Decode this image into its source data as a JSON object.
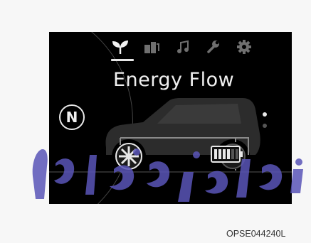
{
  "display": {
    "title": "Energy Flow",
    "gear": "N",
    "tabs": [
      {
        "name": "eco-tab",
        "icon": "leaf-icon",
        "active": true
      },
      {
        "name": "fuel-tab",
        "icon": "fuel-station-icon",
        "active": false
      },
      {
        "name": "audio-tab",
        "icon": "music-note-icon",
        "active": false
      },
      {
        "name": "service-tab",
        "icon": "wrench-icon",
        "active": false
      },
      {
        "name": "settings-tab",
        "icon": "gear-icon",
        "active": false
      }
    ],
    "page_indicator": {
      "total": 2,
      "current": 1
    }
  },
  "caption": "OPSE044240L",
  "watermark_text": "مدادخودروكارما",
  "colors": {
    "screen_bg": "#000000",
    "active_icon": "#f2f2f2",
    "inactive_icon": "#6f6f6f",
    "watermark": "#5a55b8"
  }
}
